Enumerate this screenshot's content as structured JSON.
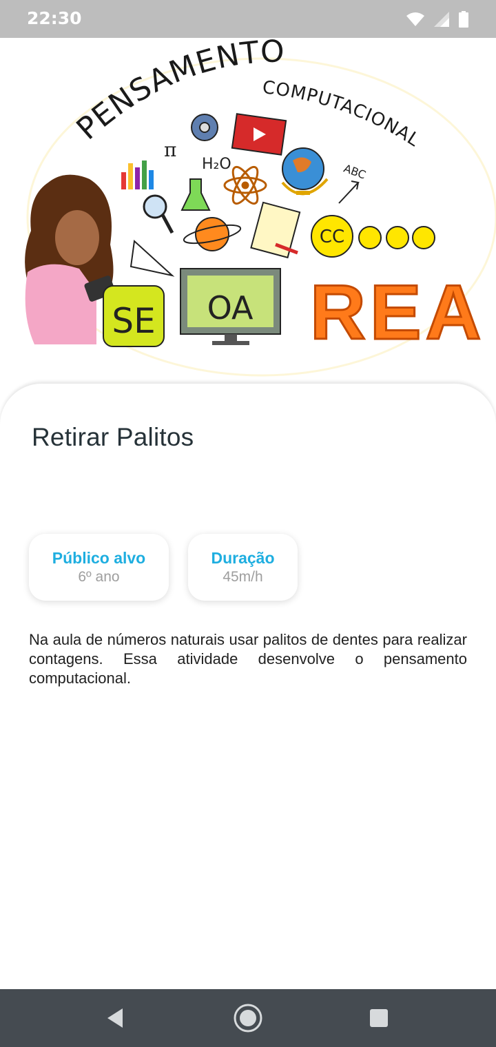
{
  "status_bar": {
    "time": "22:30"
  },
  "hero": {
    "headline_1": "PENSAMENTO",
    "headline_2": "COMPUTACIONAL",
    "tile_se": "SE",
    "tile_oa": "OA",
    "tile_rea": "REA",
    "cc_badge": "CC",
    "abc_label": "ABC",
    "pi_symbol": "π",
    "h2o_label": "H₂O",
    "colors": {
      "rea": "#ff7a1a",
      "oa_screen": "#c7e27a",
      "se_tile": "#d4e61f",
      "cc_badge": "#ffe600"
    }
  },
  "activity": {
    "title": "Retirar Palitos",
    "audience_label": "Público alvo",
    "audience_value": "6º ano",
    "duration_label": "Duração",
    "duration_value": "45m/h",
    "description": "Na aula de números  naturais usar palitos de dentes para realizar contagens. Essa atividade desenvolve o pensamento computacional."
  },
  "nav": {
    "back_icon": "back-triangle",
    "home_icon": "home-circle",
    "recents_icon": "recents-square"
  },
  "colors": {
    "accent": "#1eaee0",
    "status_bar": "#bdbdbd",
    "nav_bar": "#454b51"
  }
}
